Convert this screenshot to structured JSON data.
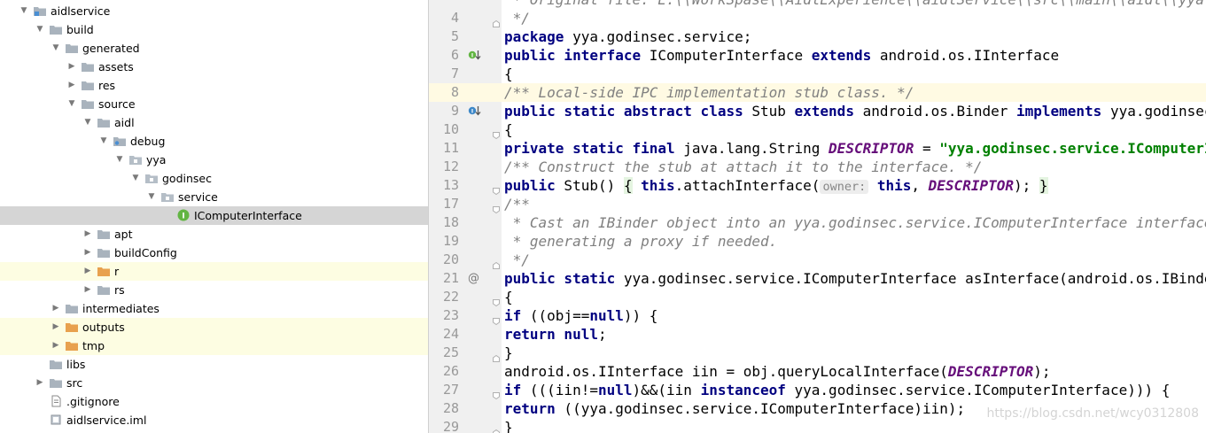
{
  "tree": [
    {
      "label": "aidlservice",
      "depth": 0,
      "arrow": "down",
      "icon": "module",
      "state": ""
    },
    {
      "label": "build",
      "depth": 1,
      "arrow": "down",
      "icon": "folder",
      "state": ""
    },
    {
      "label": "generated",
      "depth": 2,
      "arrow": "down",
      "icon": "folder",
      "state": ""
    },
    {
      "label": "assets",
      "depth": 3,
      "arrow": "right",
      "icon": "folder",
      "state": ""
    },
    {
      "label": "res",
      "depth": 3,
      "arrow": "right",
      "icon": "folder",
      "state": ""
    },
    {
      "label": "source",
      "depth": 3,
      "arrow": "down",
      "icon": "folder",
      "state": ""
    },
    {
      "label": "aidl",
      "depth": 4,
      "arrow": "down",
      "icon": "folder",
      "state": ""
    },
    {
      "label": "debug",
      "depth": 5,
      "arrow": "down",
      "icon": "source-folder",
      "state": ""
    },
    {
      "label": "yya",
      "depth": 6,
      "arrow": "down",
      "icon": "package",
      "state": ""
    },
    {
      "label": "godinsec",
      "depth": 7,
      "arrow": "down",
      "icon": "package",
      "state": ""
    },
    {
      "label": "service",
      "depth": 8,
      "arrow": "down",
      "icon": "package",
      "state": ""
    },
    {
      "label": "IComputerInterface",
      "depth": 9,
      "arrow": "none",
      "icon": "interface",
      "state": "selected"
    },
    {
      "label": "apt",
      "depth": 4,
      "arrow": "right",
      "icon": "folder",
      "state": ""
    },
    {
      "label": "buildConfig",
      "depth": 4,
      "arrow": "right",
      "icon": "folder",
      "state": ""
    },
    {
      "label": "r",
      "depth": 4,
      "arrow": "right",
      "icon": "folder-orange",
      "state": "excluded"
    },
    {
      "label": "rs",
      "depth": 4,
      "arrow": "right",
      "icon": "folder",
      "state": ""
    },
    {
      "label": "intermediates",
      "depth": 2,
      "arrow": "right",
      "icon": "folder",
      "state": ""
    },
    {
      "label": "outputs",
      "depth": 2,
      "arrow": "right",
      "icon": "folder-orange",
      "state": "excluded"
    },
    {
      "label": "tmp",
      "depth": 2,
      "arrow": "right",
      "icon": "folder-orange",
      "state": "excluded"
    },
    {
      "label": "libs",
      "depth": 1,
      "arrow": "none",
      "icon": "folder",
      "state": ""
    },
    {
      "label": "src",
      "depth": 1,
      "arrow": "right",
      "icon": "folder",
      "state": ""
    },
    {
      "label": ".gitignore",
      "depth": 1,
      "arrow": "none",
      "icon": "text-file",
      "state": ""
    },
    {
      "label": "aidlservice.iml",
      "depth": 1,
      "arrow": "none",
      "icon": "iml-file",
      "state": ""
    }
  ],
  "editor": {
    "lines": [
      {
        "num": "",
        "gutter": "",
        "fold": "",
        "hl": false,
        "tokens": [
          {
            "t": " * Original file: E:\\\\WorkSpase\\\\AidlExperience\\\\aidlService\\\\src\\\\main\\\\aidl\\\\yya",
            "c": "cm"
          }
        ]
      },
      {
        "num": "4",
        "gutter": "",
        "fold": "end",
        "hl": false,
        "tokens": [
          {
            "t": " */",
            "c": "cm"
          }
        ]
      },
      {
        "num": "5",
        "gutter": "",
        "fold": "",
        "hl": false,
        "tokens": [
          {
            "t": "package",
            "c": "kw"
          },
          {
            "t": " yya.godinsec.service;",
            "c": ""
          }
        ]
      },
      {
        "num": "6",
        "gutter": "impl",
        "fold": "",
        "hl": false,
        "tokens": [
          {
            "t": "public interface",
            "c": "kw"
          },
          {
            "t": " IComputerInterface ",
            "c": ""
          },
          {
            "t": "extends",
            "c": "kw"
          },
          {
            "t": " android.os.IInterface",
            "c": ""
          }
        ]
      },
      {
        "num": "7",
        "gutter": "",
        "fold": "",
        "hl": false,
        "tokens": [
          {
            "t": "{",
            "c": ""
          }
        ]
      },
      {
        "num": "8",
        "gutter": "",
        "fold": "",
        "hl": true,
        "tokens": [
          {
            "t": "/** Local-side IPC implementation stub class. */",
            "c": "cm"
          }
        ]
      },
      {
        "num": "9",
        "gutter": "impl-override",
        "fold": "",
        "hl": false,
        "tokens": [
          {
            "t": "public static abstract class",
            "c": "kw"
          },
          {
            "t": " Stub ",
            "c": ""
          },
          {
            "t": "extends",
            "c": "kw"
          },
          {
            "t": " android.os.Binder ",
            "c": ""
          },
          {
            "t": "implements",
            "c": "kw"
          },
          {
            "t": " yya.godinsec.service.IComputerInterface",
            "c": ""
          }
        ]
      },
      {
        "num": "10",
        "gutter": "",
        "fold": "start",
        "hl": false,
        "tokens": [
          {
            "t": "{",
            "c": ""
          }
        ]
      },
      {
        "num": "11",
        "gutter": "",
        "fold": "",
        "hl": false,
        "tokens": [
          {
            "t": "private static final",
            "c": "kw"
          },
          {
            "t": " java.lang.String ",
            "c": ""
          },
          {
            "t": "DESCRIPTOR",
            "c": "cst"
          },
          {
            "t": " = ",
            "c": ""
          },
          {
            "t": "\"yya.godinsec.service.IComputerInterface\"",
            "c": "st"
          },
          {
            "t": ";",
            "c": ""
          }
        ]
      },
      {
        "num": "12",
        "gutter": "",
        "fold": "",
        "hl": false,
        "tokens": [
          {
            "t": "/** Construct the stub at attach it to the interface. */",
            "c": "cm"
          }
        ]
      },
      {
        "num": "13",
        "gutter": "",
        "fold": "start",
        "hl": false,
        "tokens": [
          {
            "t": "public",
            "c": "kw"
          },
          {
            "t": " Stub() ",
            "c": ""
          },
          {
            "t": "{",
            "c": "br"
          },
          {
            "t": " ",
            "c": ""
          },
          {
            "t": "this",
            "c": "kw"
          },
          {
            "t": ".attachInterface(",
            "c": ""
          },
          {
            "t": "owner:",
            "c": "hint"
          },
          {
            "t": " ",
            "c": ""
          },
          {
            "t": "this",
            "c": "kw"
          },
          {
            "t": ", ",
            "c": ""
          },
          {
            "t": "DESCRIPTOR",
            "c": "cst"
          },
          {
            "t": "); ",
            "c": ""
          },
          {
            "t": "}",
            "c": "br"
          }
        ]
      },
      {
        "num": "17",
        "gutter": "",
        "fold": "start",
        "hl": false,
        "tokens": [
          {
            "t": "/**",
            "c": "cm"
          }
        ]
      },
      {
        "num": "18",
        "gutter": "",
        "fold": "",
        "hl": false,
        "tokens": [
          {
            "t": " * Cast an IBinder object into an yya.godinsec.service.IComputerInterface interface,",
            "c": "cm"
          }
        ]
      },
      {
        "num": "19",
        "gutter": "",
        "fold": "",
        "hl": false,
        "tokens": [
          {
            "t": " * generating a proxy if needed.",
            "c": "cm"
          }
        ]
      },
      {
        "num": "20",
        "gutter": "",
        "fold": "end",
        "hl": false,
        "tokens": [
          {
            "t": " */",
            "c": "cm"
          }
        ]
      },
      {
        "num": "21",
        "gutter": "at",
        "fold": "",
        "hl": false,
        "tokens": [
          {
            "t": "public static",
            "c": "kw"
          },
          {
            "t": " yya.godinsec.service.IComputerInterface asInterface(android.os.IBinder obj)",
            "c": ""
          }
        ]
      },
      {
        "num": "22",
        "gutter": "",
        "fold": "start",
        "hl": false,
        "tokens": [
          {
            "t": "{",
            "c": ""
          }
        ]
      },
      {
        "num": "23",
        "gutter": "",
        "fold": "start",
        "hl": false,
        "tokens": [
          {
            "t": "if",
            "c": "kw"
          },
          {
            "t": " ((obj==",
            "c": ""
          },
          {
            "t": "null",
            "c": "kw"
          },
          {
            "t": ")) {",
            "c": ""
          }
        ]
      },
      {
        "num": "24",
        "gutter": "",
        "fold": "",
        "hl": false,
        "tokens": [
          {
            "t": "return null",
            "c": "kw"
          },
          {
            "t": ";",
            "c": ""
          }
        ]
      },
      {
        "num": "25",
        "gutter": "",
        "fold": "end",
        "hl": false,
        "tokens": [
          {
            "t": "}",
            "c": ""
          }
        ]
      },
      {
        "num": "26",
        "gutter": "",
        "fold": "",
        "hl": false,
        "tokens": [
          {
            "t": "android.os.IInterface iin = obj.queryLocalInterface(",
            "c": ""
          },
          {
            "t": "DESCRIPTOR",
            "c": "cst"
          },
          {
            "t": ");",
            "c": ""
          }
        ]
      },
      {
        "num": "27",
        "gutter": "",
        "fold": "start",
        "hl": false,
        "tokens": [
          {
            "t": "if",
            "c": "kw"
          },
          {
            "t": " (((iin!=",
            "c": ""
          },
          {
            "t": "null",
            "c": "kw"
          },
          {
            "t": ")&&(iin ",
            "c": ""
          },
          {
            "t": "instanceof",
            "c": "kw"
          },
          {
            "t": " yya.godinsec.service.IComputerInterface))) {",
            "c": ""
          }
        ]
      },
      {
        "num": "28",
        "gutter": "",
        "fold": "",
        "hl": false,
        "tokens": [
          {
            "t": "return",
            "c": "kw"
          },
          {
            "t": " ((yya.godinsec.service.IComputerInterface)iin);",
            "c": ""
          }
        ]
      },
      {
        "num": "29",
        "gutter": "",
        "fold": "end",
        "hl": false,
        "tokens": [
          {
            "t": "}",
            "c": ""
          }
        ]
      }
    ]
  },
  "watermark": "https://blog.csdn.net/wcy0312808",
  "colors": {
    "folder": "#a9b3bd",
    "folder_orange": "#e8a14e",
    "package": "#b5bec7",
    "interface": "#62b543",
    "selected": "#d5d5d5",
    "excluded": "#fdfde2"
  }
}
